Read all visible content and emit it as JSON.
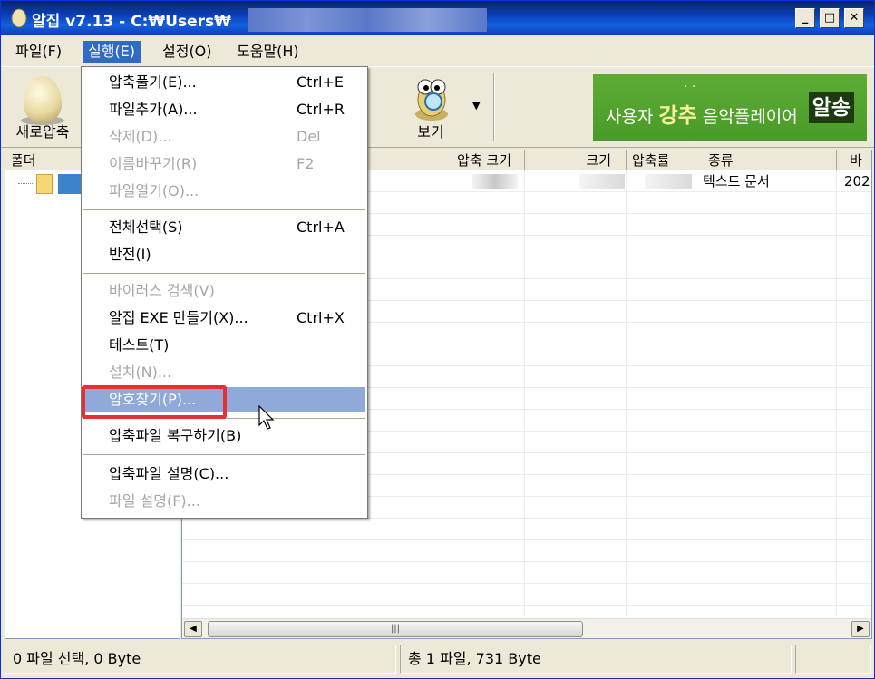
{
  "title_bar": {
    "title": "알집 v7.13 - C:₩Users₩",
    "min": "_",
    "max": "□",
    "close": "✕"
  },
  "menu_bar": {
    "file": "파일(F)",
    "run": "실행(E)",
    "settings": "설정(O)",
    "help": "도움말(H)"
  },
  "toolbar": {
    "new_archive": "새로압축",
    "view": "보기",
    "dropdown_arrow": "▼"
  },
  "banner": {
    "part1": "사용자 ",
    "part2": "강추",
    "part3": " 음악플레이어 ",
    "part4": "알송",
    "dots": "· ·"
  },
  "columns": {
    "folder": "폴더",
    "compressed_size": "압축 크기",
    "size": "크기",
    "ratio": "압축률",
    "type": "종류",
    "modified": "바"
  },
  "file_row": {
    "type": "텍스트 문서",
    "modified": "202"
  },
  "run_menu": {
    "extract": "압축풀기(E)...",
    "extract_sc": "Ctrl+E",
    "add_files": "파일추가(A)...",
    "add_files_sc": "Ctrl+R",
    "delete": "삭제(D)...",
    "delete_sc": "Del",
    "rename": "이름바꾸기(R)",
    "rename_sc": "F2",
    "open_file": "파일열기(O)...",
    "select_all": "전체선택(S)",
    "select_all_sc": "Ctrl+A",
    "invert": "반전(I)",
    "virus_scan": "바이러스 검색(V)",
    "make_exe": "알집 EXE 만들기(X)...",
    "make_exe_sc": "Ctrl+X",
    "test": "테스트(T)",
    "install": "설치(N)...",
    "find_password": "암호찾기(P)...",
    "repair": "압축파일 복구하기(B)",
    "archive_comment": "압축파일 설명(C)...",
    "file_comment": "파일 설명(F)..."
  },
  "status_bar": {
    "selection": "0 파일 선택,  0 Byte",
    "total": "총 1 파일,  731 Byte"
  },
  "colors": {
    "title_bar": "#0a3eb6",
    "highlight": "#8faad8",
    "menu_active": "#316ac5",
    "red_box": "#e83030",
    "banner": "#4a9a2a"
  }
}
